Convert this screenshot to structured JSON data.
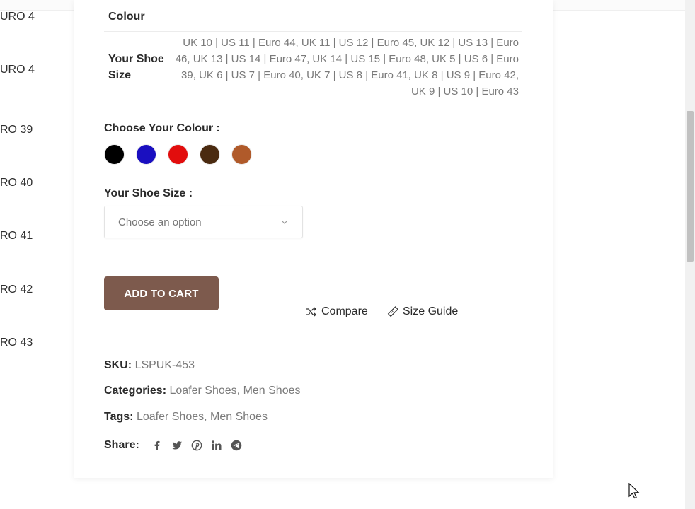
{
  "left_list": [
    "URO 4",
    "URO 4",
    "RO 39",
    "RO 40",
    "RO 41",
    "RO 42",
    "RO 43"
  ],
  "attributes": {
    "colour_label": "Colour",
    "shoe_size_label": "Your Shoe Size",
    "shoe_size_values": "UK 10 | US 11 | Euro 44, UK 11 | US 12 | Euro 45, UK 12 | US 13 | Euro 46, UK 13 | US 14 | Euro 47, UK 14 | US 15 | Euro 48, UK 5 | US 6 | Euro 39, UK 6 | US 7 | Euro 40, UK 7 | US 8 | Euro 41, UK 8 | US 9 | Euro 42, UK 9 | US 10 | Euro 43"
  },
  "colour_picker": {
    "label": "Choose Your Colour :",
    "swatches": [
      {
        "name": "black",
        "color": "#000000"
      },
      {
        "name": "blue",
        "color": "#1a0fc0"
      },
      {
        "name": "red",
        "color": "#e20d0d"
      },
      {
        "name": "dark-brown",
        "color": "#4a2a10"
      },
      {
        "name": "tan-brown",
        "color": "#b05a2a"
      }
    ]
  },
  "size_picker": {
    "label": "Your Shoe Size :",
    "placeholder": "Choose an option"
  },
  "actions": {
    "add_to_cart": "ADD TO CART",
    "compare": "Compare",
    "size_guide": "Size Guide"
  },
  "meta": {
    "sku_label": "SKU:",
    "sku_value": "LSPUK-453",
    "categories_label": "Categories:",
    "categories": [
      "Loafer Shoes",
      "Men Shoes"
    ],
    "tags_label": "Tags:",
    "tags": [
      "Loafer Shoes",
      "Men Shoes"
    ],
    "share_label": "Share:",
    "share_icons": [
      "facebook-icon",
      "twitter-icon",
      "pinterest-icon",
      "linkedin-icon",
      "telegram-icon"
    ]
  },
  "colors": {
    "accent": "#7d5a4d",
    "muted_text": "#7a7a7a"
  }
}
